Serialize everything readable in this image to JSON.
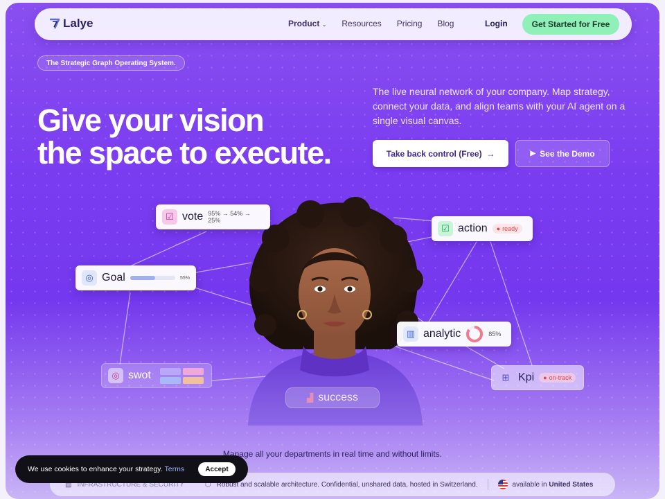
{
  "nav": {
    "brand": "Lalye",
    "links": [
      "Product",
      "Resources",
      "Pricing",
      "Blog"
    ],
    "login": "Login",
    "cta": "Get Started for Free"
  },
  "hero": {
    "pill": "The Strategic Graph Operating System.",
    "headline_line1": "Give your vision",
    "headline_line2": "the space to execute.",
    "subtitle": "The live neural network of your company. Map strategy, connect your data, and align teams with your AI agent on a single visual canvas.",
    "primary_button": "Take back control (Free)",
    "primary_arrow": "→",
    "secondary_button": "See the Demo"
  },
  "nodes": {
    "vote": {
      "label": "vote",
      "stats": "95% → 54% → 25%"
    },
    "goal": {
      "label": "Goal",
      "percent": "55%",
      "progress": 0.55
    },
    "swot": {
      "label": "swot"
    },
    "action": {
      "label": "action",
      "status": "ready"
    },
    "analytic": {
      "label": "analytic",
      "percent": "85%",
      "value": 0.85
    },
    "kpi": {
      "label": "Kpi",
      "status": "on-track"
    },
    "success": {
      "label": "success"
    }
  },
  "tagline": "Manage all your departments in real time and without limits.",
  "infobar": {
    "item1": "INFRASTRUCTURE & SECURITY",
    "item2": "Robust and scalable architecture. Confidential, unshared data, hosted in Switzerland.",
    "item3_prefix": "available in",
    "item3_country": "United States"
  },
  "cookie": {
    "text": "We use cookies to enhance your strategy.",
    "link": "Terms",
    "accept": "Accept"
  },
  "colors": {
    "accent_green": "#8ff0b8",
    "brand_purple": "#7a3cf0",
    "status_red": "#e0474c"
  }
}
